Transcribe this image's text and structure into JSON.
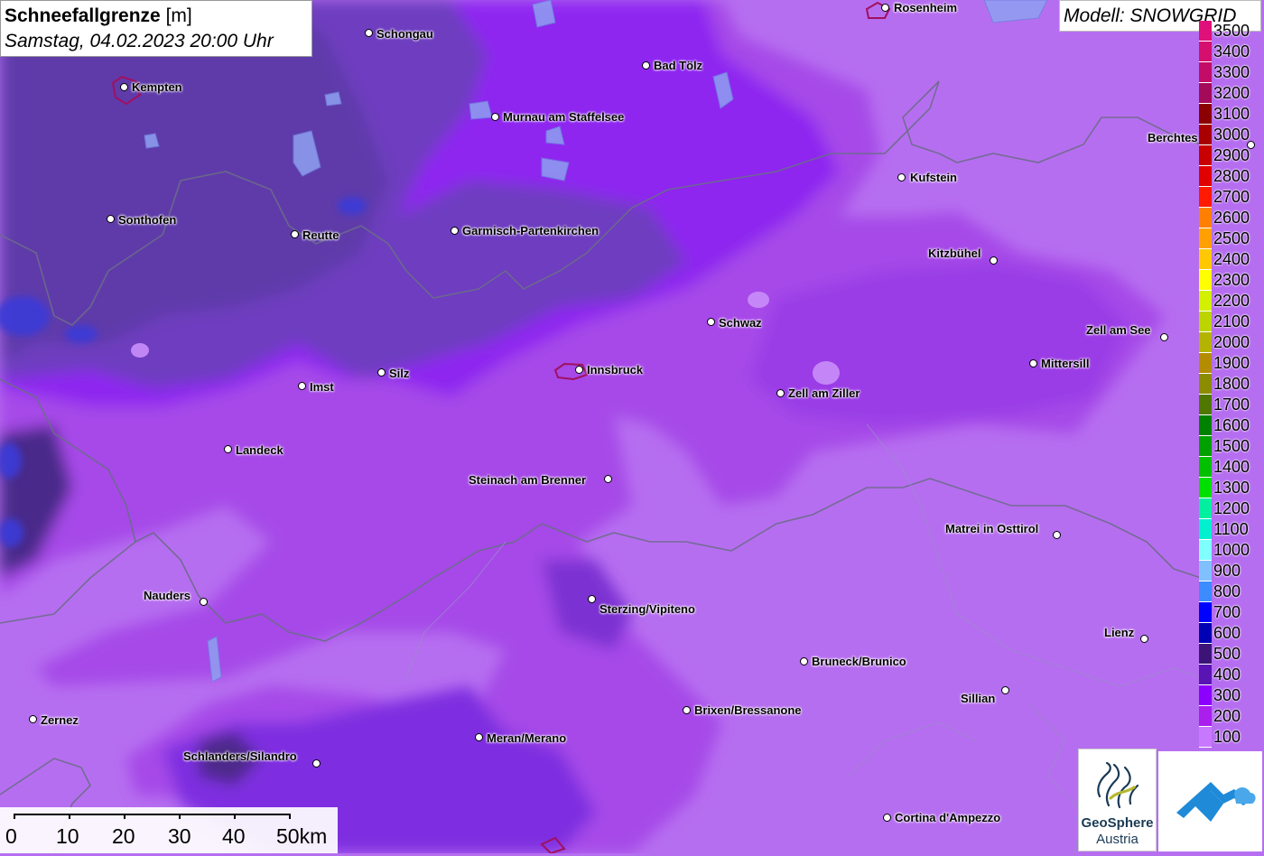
{
  "header": {
    "title": "Schneefallgrenze",
    "unit": "[m]",
    "datetime": "Samstag, 04.02.2023 20:00 Uhr",
    "model": "Modell: SNOWGRID"
  },
  "legend": {
    "items": [
      {
        "label": "3500",
        "color": "#e0107a"
      },
      {
        "label": "3400",
        "color": "#d40f6e"
      },
      {
        "label": "3300",
        "color": "#c20c68"
      },
      {
        "label": "3200",
        "color": "#a40a5a"
      },
      {
        "label": "3100",
        "color": "#8b0000"
      },
      {
        "label": "3000",
        "color": "#a80000"
      },
      {
        "label": "2900",
        "color": "#c80000"
      },
      {
        "label": "2800",
        "color": "#e00000"
      },
      {
        "label": "2700",
        "color": "#ff1a00"
      },
      {
        "label": "2600",
        "color": "#ff8000"
      },
      {
        "label": "2500",
        "color": "#ffa000"
      },
      {
        "label": "2400",
        "color": "#ffc800"
      },
      {
        "label": "2300",
        "color": "#ffff00"
      },
      {
        "label": "2200",
        "color": "#d2f000"
      },
      {
        "label": "2100",
        "color": "#bcd400"
      },
      {
        "label": "2000",
        "color": "#b4b400"
      },
      {
        "label": "1900",
        "color": "#b48c00"
      },
      {
        "label": "1800",
        "color": "#8c8c00"
      },
      {
        "label": "1700",
        "color": "#507800"
      },
      {
        "label": "1600",
        "color": "#008200"
      },
      {
        "label": "1500",
        "color": "#00a000"
      },
      {
        "label": "1400",
        "color": "#00c000"
      },
      {
        "label": "1300",
        "color": "#00e000"
      },
      {
        "label": "1200",
        "color": "#00f0a0"
      },
      {
        "label": "1100",
        "color": "#00f0d0"
      },
      {
        "label": "1000",
        "color": "#80ffff"
      },
      {
        "label": "900",
        "color": "#80c0ff"
      },
      {
        "label": "800",
        "color": "#3c8cff"
      },
      {
        "label": "700",
        "color": "#0000ff"
      },
      {
        "label": "600",
        "color": "#0000b4"
      },
      {
        "label": "500",
        "color": "#3c1478"
      },
      {
        "label": "400",
        "color": "#5a14b4"
      },
      {
        "label": "300",
        "color": "#8c00ff"
      },
      {
        "label": "200",
        "color": "#aa1eee"
      },
      {
        "label": "100",
        "color": "#c878ff"
      }
    ]
  },
  "cities": [
    {
      "name": "Rosenheim"
    },
    {
      "name": "Schongau"
    },
    {
      "name": "Bad Tölz"
    },
    {
      "name": "Kempten"
    },
    {
      "name": "Murnau am Staffelsee"
    },
    {
      "name": "Berchtes"
    },
    {
      "name": "Kufstein"
    },
    {
      "name": "Sonthofen"
    },
    {
      "name": "Reutte"
    },
    {
      "name": "Garmisch-Partenkirchen"
    },
    {
      "name": "Kitzbühel"
    },
    {
      "name": "Schwaz"
    },
    {
      "name": "Zell am See"
    },
    {
      "name": "Mittersill"
    },
    {
      "name": "Silz"
    },
    {
      "name": "Innsbruck"
    },
    {
      "name": "Imst"
    },
    {
      "name": "Zell am Ziller"
    },
    {
      "name": "Landeck"
    },
    {
      "name": "Steinach am Brenner"
    },
    {
      "name": "Matrei in Osttirol"
    },
    {
      "name": "Nauders"
    },
    {
      "name": "Sterzing/Vipiteno"
    },
    {
      "name": "Lienz"
    },
    {
      "name": "Bruneck/Brunico"
    },
    {
      "name": "Sillian"
    },
    {
      "name": "Zernez"
    },
    {
      "name": "Brixen/Bressanone"
    },
    {
      "name": "Meran/Merano"
    },
    {
      "name": "Schlanders/Silandro"
    },
    {
      "name": "Cortina d'Ampezzo"
    }
  ],
  "scalebar": {
    "labels": [
      "0",
      "10",
      "20",
      "30",
      "40",
      "50km"
    ]
  },
  "logos": {
    "geosphere_line1": "GeoSphere",
    "geosphere_line2": "Austria"
  }
}
